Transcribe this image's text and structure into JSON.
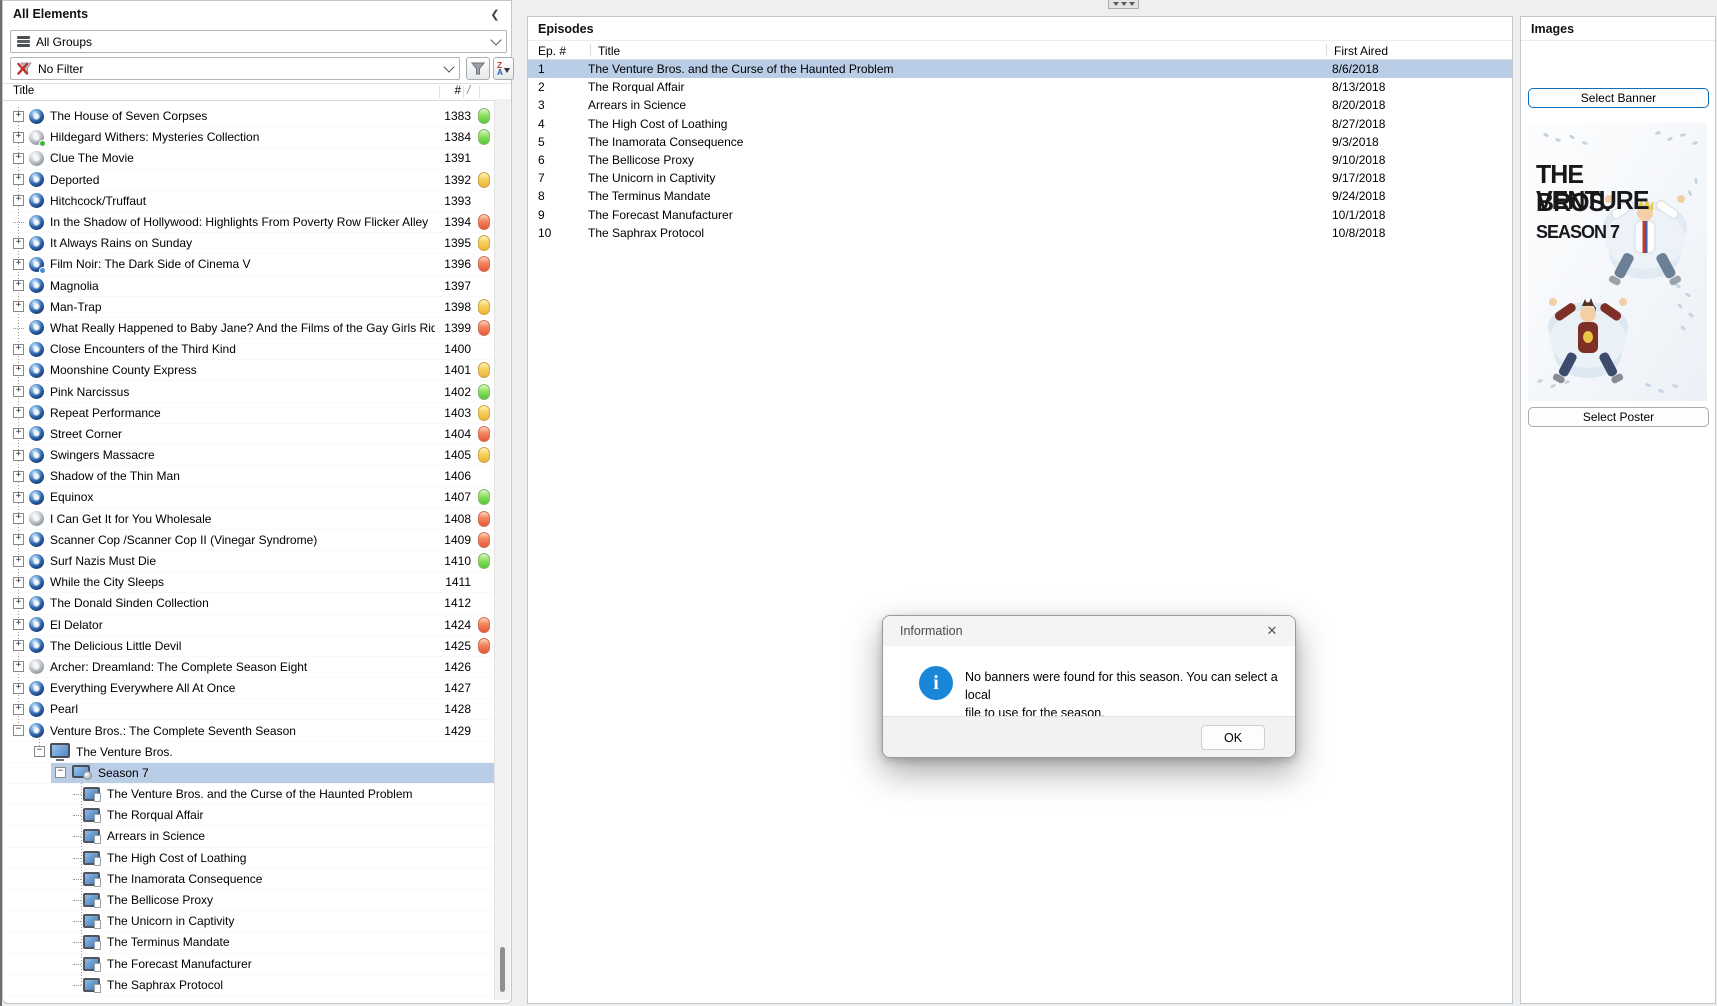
{
  "left_panel": {
    "title": "All Elements",
    "collapse_icon": "❮",
    "groups_dropdown": {
      "value": "All Groups"
    },
    "filter_dropdown": {
      "value": "No Filter"
    },
    "columns": {
      "title": "Title",
      "number": "#",
      "slash": "/"
    },
    "items": [
      {
        "t": "The House of Seven Corpses",
        "n": "1383",
        "disc": "blue",
        "status": "green"
      },
      {
        "t": "Hildegard Withers: Mysteries Collection",
        "n": "1384",
        "disc": "gray",
        "badge": "green",
        "status": "green"
      },
      {
        "t": "Clue The Movie",
        "n": "1391",
        "disc": "gray",
        "status": ""
      },
      {
        "t": "Deported",
        "n": "1392",
        "disc": "blue",
        "status": "yellow"
      },
      {
        "t": "Hitchcock/Truffaut",
        "n": "1393",
        "disc": "blue",
        "status": ""
      },
      {
        "t": "In the Shadow of Hollywood: Highlights From Poverty Row Flicker Alley",
        "n": "1394",
        "disc": "blue",
        "status": "red",
        "leaf": true
      },
      {
        "t": "It Always Rains on Sunday",
        "n": "1395",
        "disc": "blue",
        "status": "yellow"
      },
      {
        "t": "Film Noir: The Dark Side of Cinema V",
        "n": "1396",
        "disc": "blue",
        "badge": "blue",
        "status": "red"
      },
      {
        "t": "Magnolia",
        "n": "1397",
        "disc": "blue",
        "status": ""
      },
      {
        "t": "Man-Trap",
        "n": "1398",
        "disc": "blue",
        "status": "yellow"
      },
      {
        "t": "What Really Happened to Baby Jane? And the Films of the Gay Girls Riding Club",
        "n": "1399",
        "disc": "blue",
        "status": "red",
        "leaf": true
      },
      {
        "t": "Close Encounters of the Third Kind",
        "n": "1400",
        "disc": "blue",
        "status": ""
      },
      {
        "t": "Moonshine County Express",
        "n": "1401",
        "disc": "blue",
        "status": "yellow"
      },
      {
        "t": "Pink Narcissus",
        "n": "1402",
        "disc": "blue",
        "status": "green"
      },
      {
        "t": "Repeat Performance",
        "n": "1403",
        "disc": "blue",
        "status": "yellow"
      },
      {
        "t": "Street Corner",
        "n": "1404",
        "disc": "blue",
        "status": "red"
      },
      {
        "t": "Swingers Massacre",
        "n": "1405",
        "disc": "blue",
        "status": "yellow"
      },
      {
        "t": "Shadow of the Thin Man",
        "n": "1406",
        "disc": "blue",
        "status": ""
      },
      {
        "t": "Equinox",
        "n": "1407",
        "disc": "blue",
        "status": "green"
      },
      {
        "t": "I Can Get It for You Wholesale",
        "n": "1408",
        "disc": "gray",
        "status": "red"
      },
      {
        "t": "Scanner Cop /Scanner Cop II (Vinegar Syndrome)",
        "n": "1409",
        "disc": "blue",
        "status": "red"
      },
      {
        "t": "Surf Nazis Must Die",
        "n": "1410",
        "disc": "blue",
        "status": "green"
      },
      {
        "t": "While the City Sleeps",
        "n": "1411",
        "disc": "blue",
        "status": ""
      },
      {
        "t": "The Donald Sinden Collection",
        "n": "1412",
        "disc": "blue",
        "status": ""
      },
      {
        "t": "El Delator",
        "n": "1424",
        "disc": "blue",
        "status": "red"
      },
      {
        "t": "The Delicious Little Devil",
        "n": "1425",
        "disc": "blue",
        "status": "red"
      },
      {
        "t": "Archer: Dreamland: The Complete Season Eight",
        "n": "1426",
        "disc": "gray",
        "status": ""
      },
      {
        "t": "Everything Everywhere All At Once",
        "n": "1427",
        "disc": "blue",
        "status": ""
      },
      {
        "t": "Pearl",
        "n": "1428",
        "disc": "blue",
        "status": ""
      },
      {
        "t": "Venture Bros.: The Complete Seventh Season",
        "n": "1429",
        "disc": "blue",
        "status": "",
        "expanded": true
      }
    ],
    "subtree": {
      "series_label": "The Venture Bros.",
      "season_label": "Season 7",
      "episodes": [
        "The Venture Bros. and the Curse of the Haunted Problem",
        "The Rorqual Affair",
        "Arrears in Science",
        "The High Cost of Loathing",
        "The Inamorata Consequence",
        "The Bellicose Proxy",
        "The Unicorn in Captivity",
        "The Terminus Mandate",
        "The Forecast Manufacturer",
        "The Saphrax Protocol"
      ]
    }
  },
  "episodes_panel": {
    "title": "Episodes",
    "columns": {
      "num": "Ep. #",
      "title": "Title",
      "aired": "First Aired"
    },
    "rows": [
      {
        "num": "1",
        "title": "The Venture Bros. and the Curse of the Haunted Problem",
        "aired": "8/6/2018",
        "selected": true
      },
      {
        "num": "2",
        "title": "The Rorqual Affair",
        "aired": "8/13/2018"
      },
      {
        "num": "3",
        "title": "Arrears in Science",
        "aired": "8/20/2018"
      },
      {
        "num": "4",
        "title": "The High Cost of Loathing",
        "aired": "8/27/2018"
      },
      {
        "num": "5",
        "title": "The Inamorata Consequence",
        "aired": "9/3/2018"
      },
      {
        "num": "6",
        "title": "The Bellicose Proxy",
        "aired": "9/10/2018"
      },
      {
        "num": "7",
        "title": "The Unicorn in Captivity",
        "aired": "9/17/2018"
      },
      {
        "num": "8",
        "title": "The Terminus Mandate",
        "aired": "9/24/2018"
      },
      {
        "num": "9",
        "title": "The Forecast Manufacturer",
        "aired": "10/1/2018"
      },
      {
        "num": "10",
        "title": "The Saphrax Protocol",
        "aired": "10/8/2018"
      }
    ]
  },
  "images_panel": {
    "title": "Images",
    "select_banner_label": "Select Banner",
    "select_poster_label": "Select Poster",
    "poster": {
      "line1": "THE VENTURE",
      "line2": "BROS.",
      "line3": "SEASON 7"
    }
  },
  "dialog": {
    "title": "Information",
    "message_line1": "No banners were found for this season. You can select a local",
    "message_line2": "file to use for the season.",
    "info_glyph": "i",
    "close_glyph": "✕",
    "ok_label": "OK"
  },
  "colors": {
    "selection": "#b9cde6",
    "focus_accent": "#0b6fc2",
    "info_blue": "#1a86d8",
    "pill_green": "#57c53b",
    "pill_yellow": "#eab33b",
    "pill_red": "#e8543c"
  }
}
